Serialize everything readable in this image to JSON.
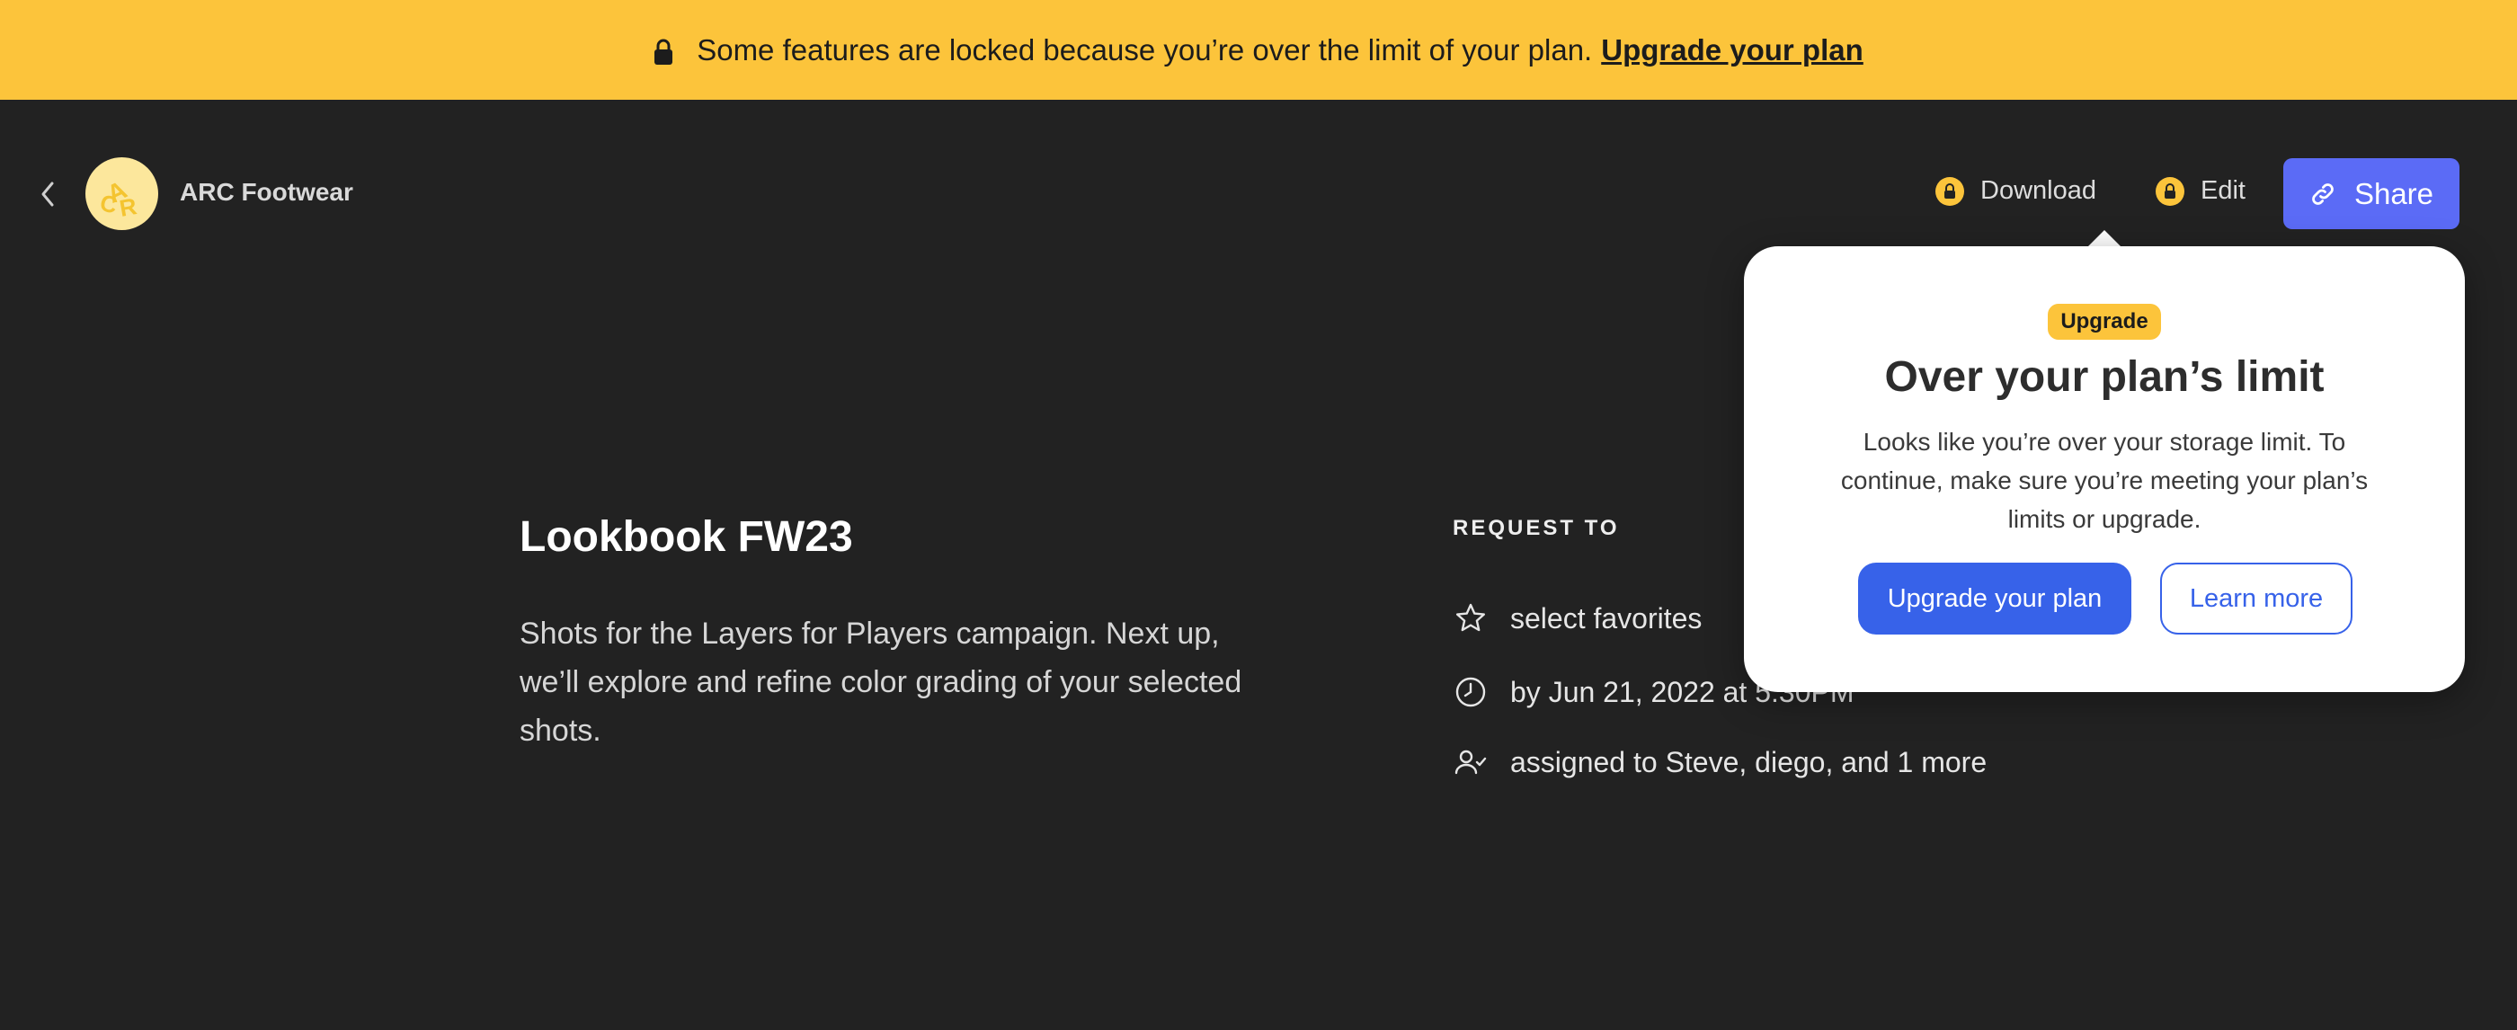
{
  "banner": {
    "message": "Some features are locked because you’re over the limit of your plan.",
    "link": "Upgrade your plan"
  },
  "header": {
    "brand_name": "ARC Footwear",
    "avatar_text": "ARC",
    "download_label": "Download",
    "edit_label": "Edit",
    "share_label": "Share"
  },
  "popover": {
    "badge": "Upgrade",
    "title": "Over your plan’s limit",
    "body": "Looks like you’re over your storage limit. To continue, make sure you’re meeting your plan’s limits or upgrade.",
    "primary_button": "Upgrade your plan",
    "secondary_button": "Learn more"
  },
  "main": {
    "title": "Lookbook FW23",
    "description": "Shots for the Layers for Players campaign. Next up, we’ll explore and refine color grading of your selected shots."
  },
  "request": {
    "label": "REQUEST TO",
    "items": [
      {
        "icon": "star-icon",
        "text": "select favorites"
      },
      {
        "icon": "clock-icon",
        "text": "by Jun 21, 2022 at 5:30PM"
      },
      {
        "icon": "user-check-icon",
        "text": "assigned to Steve, diego, and 1 more"
      }
    ]
  },
  "colors": {
    "background": "#222222",
    "banner": "#fcc43b",
    "share_button": "#5b6bf6",
    "primary_button": "#3762e9"
  }
}
